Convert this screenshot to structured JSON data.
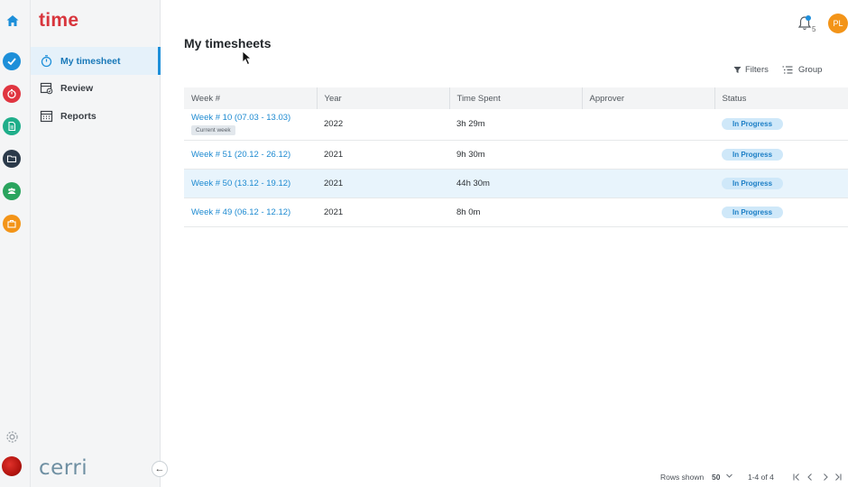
{
  "app": {
    "name": "time",
    "brand": "cerri"
  },
  "nav": {
    "items": [
      {
        "label": "My timesheet",
        "icon": "stopwatch-icon",
        "active": true
      },
      {
        "label": "Review",
        "icon": "calendar-check-icon",
        "active": false
      },
      {
        "label": "Reports",
        "icon": "calendar-grid-icon",
        "active": false
      }
    ]
  },
  "rail": {
    "apps": [
      {
        "icon": "checkmark-icon",
        "color": "#1d8fd9"
      },
      {
        "icon": "timer-icon",
        "color": "#e03540"
      },
      {
        "icon": "document-icon",
        "color": "#1fae8a"
      },
      {
        "icon": "folder-icon",
        "color": "#2b3a4a"
      },
      {
        "icon": "people-icon",
        "color": "#2aa45e"
      },
      {
        "icon": "briefcase-icon",
        "color": "#f39418"
      }
    ]
  },
  "header": {
    "title": "My timesheets",
    "notifications_count": "5",
    "avatar_initials": "PL"
  },
  "toolbar": {
    "filters_label": "Filters",
    "group_label": "Group"
  },
  "table": {
    "columns": [
      "Week #",
      "Year",
      "Time Spent",
      "Approver",
      "Status"
    ],
    "rows": [
      {
        "week": "Week # 10 (07.03 - 13.03)",
        "badge": "Current week",
        "year": "2022",
        "time": "3h 29m",
        "approver": "",
        "status": "In Progress"
      },
      {
        "week": "Week # 51 (20.12 - 26.12)",
        "badge": "",
        "year": "2021",
        "time": "9h 30m",
        "approver": "",
        "status": "In Progress"
      },
      {
        "week": "Week # 50 (13.12 - 19.12)",
        "badge": "",
        "year": "2021",
        "time": "44h 30m",
        "approver": "",
        "status": "In Progress"
      },
      {
        "week": "Week # 49 (06.12 - 12.12)",
        "badge": "",
        "year": "2021",
        "time": "8h 0m",
        "approver": "",
        "status": "In Progress"
      }
    ]
  },
  "footer": {
    "rows_shown_label": "Rows shown",
    "rows_shown_value": "50",
    "range": "1-4 of 4"
  },
  "colors": {
    "accent": "#1d8fd9",
    "brand_red": "#d8353d",
    "status_bg": "#cfe8f9"
  }
}
